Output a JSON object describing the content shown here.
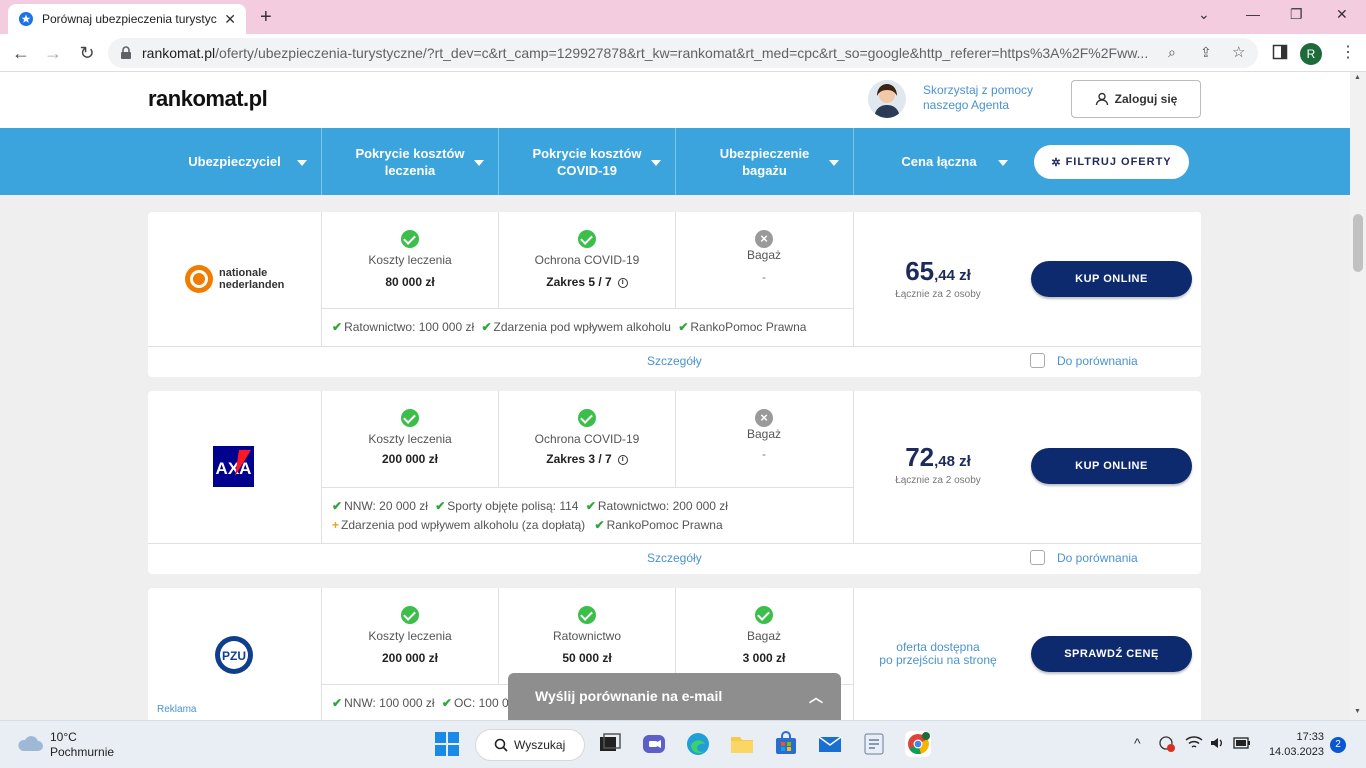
{
  "browser": {
    "tab_title": "Porównaj ubezpieczenia turystyc",
    "url_host": "rankomat.pl",
    "url_path": "/oferty/ubezpieczenia-turystyczne/?rt_dev=c&rt_camp=129927878&rt_kw=rankomat&rt_med=cpc&rt_so=google&http_referer=https%3A%2F%2Fww...",
    "profile_initial": "R"
  },
  "header": {
    "logo": "rankomat.pl",
    "agent_text": "Skorzystaj z pomocy naszego Agenta",
    "login_label": "Zaloguj się"
  },
  "filters": {
    "columns": [
      "Ubezpieczyciel",
      "Pokrycie kosztów leczenia",
      "Pokrycie kosztów COVID-19",
      "Ubezpieczenie bagażu",
      "Cena łączna"
    ],
    "filter_button": "FILTRUJ OFERTY"
  },
  "offers": [
    {
      "insurer": "nationale nederlanden",
      "insurer_line1": "nationale",
      "insurer_line2": "nederlanden",
      "c1_label": "Koszty leczenia",
      "c1_value": "80 000 zł",
      "c1_status": "ok",
      "c2_label": "Ochrona COVID-19",
      "c2_value": "Zakres 5 / 7",
      "c2_status": "ok",
      "c3_label": "Bagaż",
      "c3_value": "-",
      "c3_status": "no",
      "features_line1": [
        "Ratownictwo: 100 000 zł",
        "Zdarzenia pod wpływem alkoholu",
        "RankoPomoc Prawna"
      ],
      "price_main": "65",
      "price_dec": ",44 zł",
      "price_sub": "Łącznie za 2 osoby",
      "button": "KUP ONLINE",
      "details": "Szczegóły",
      "compare": "Do porównania"
    },
    {
      "insurer": "AXA",
      "c1_label": "Koszty leczenia",
      "c1_value": "200 000 zł",
      "c1_status": "ok",
      "c2_label": "Ochrona COVID-19",
      "c2_value": "Zakres 3 / 7",
      "c2_status": "ok",
      "c3_label": "Bagaż",
      "c3_value": "-",
      "c3_status": "no",
      "features_line1": [
        "NNW: 20 000 zł",
        "Sporty objęte polisą: 114",
        "Ratownictwo: 200 000 zł"
      ],
      "features_line2_plus": "Zdarzenia pod wpływem alkoholu (za dopłatą)",
      "features_line2_tick": "RankoPomoc Prawna",
      "price_main": "72",
      "price_dec": ",48 zł",
      "price_sub": "Łącznie za 2 osoby",
      "button": "KUP ONLINE",
      "details": "Szczegóły",
      "compare": "Do porównania"
    },
    {
      "insurer": "PZU",
      "ad_label": "Reklama",
      "c1_label": "Koszty leczenia",
      "c1_value": "200 000 zł",
      "c1_status": "ok",
      "c2_label": "Ratownictwo",
      "c2_value": "50 000 zł",
      "c2_status": "ok",
      "c3_label": "Bagaż",
      "c3_value": "3 000 zł",
      "c3_status": "ok",
      "features_line1": [
        "NNW: 100 000 zł",
        "OC: 100 0"
      ],
      "price_note_line1": "oferta dostępna",
      "price_note_line2": "po przejściu na stronę",
      "button": "SPRAWDŹ CENĘ"
    }
  ],
  "email_bar": {
    "label": "Wyślij porównanie na e-mail"
  },
  "taskbar": {
    "temp": "10°C",
    "weather": "Pochmurnie",
    "search": "Wyszukaj",
    "time": "17:33",
    "date": "14.03.2023",
    "notifications": "2"
  },
  "colors": {
    "brand_blue": "#3ba4dc",
    "navy_button": "#0e2a6e",
    "link": "#4a93cf",
    "check_green": "#3bbf4a"
  }
}
